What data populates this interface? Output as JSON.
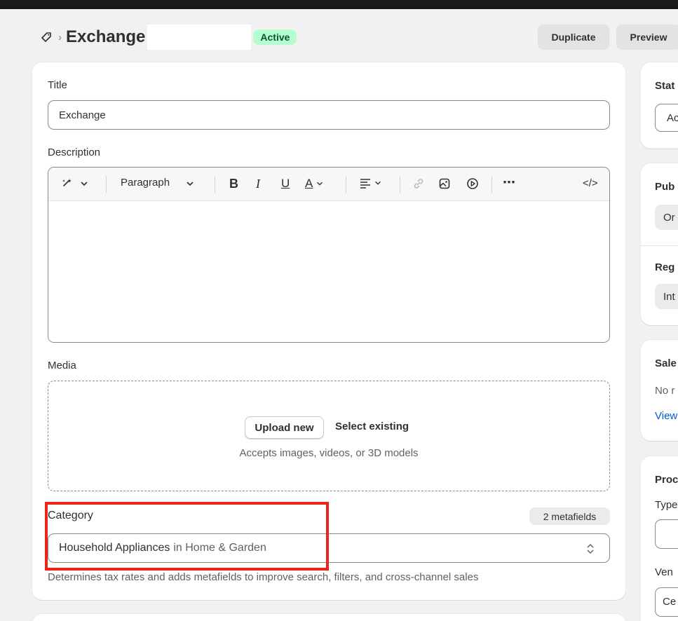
{
  "header": {
    "title": "Exchange",
    "status_badge": "Active",
    "duplicate_label": "Duplicate",
    "preview_label": "Preview"
  },
  "main": {
    "title_label": "Title",
    "title_value": "Exchange",
    "description_label": "Description",
    "toolbar": {
      "paragraph_label": "Paragraph",
      "bold": "B",
      "italic": "I",
      "underline": "U",
      "text_color": "A",
      "more": "⋯",
      "code": "</>"
    },
    "media_label": "Media",
    "upload_new": "Upload new",
    "select_existing": "Select existing",
    "media_hint": "Accepts images, videos, or 3D models",
    "category_label": "Category",
    "metafields_badge": "2 metafields",
    "category_value": "Household Appliances",
    "category_parent": "in Home & Garden",
    "category_help": "Determines tax rates and adds metafields to improve search, filters, and cross-channel sales"
  },
  "sidebar": {
    "status_label": "Stat",
    "status_value": "Ac",
    "publishing_label": "Pub",
    "publishing_value": "Or",
    "regions_label": "Reg",
    "regions_value": "Int",
    "sales_label": "Sale",
    "sales_text": "No r",
    "sales_link": "View",
    "product_org_label": "Proc",
    "type_label": "Type",
    "vendor_label": "Ven",
    "vendor_value": "Ce"
  },
  "colors": {
    "active_badge_bg": "#b4fed2",
    "active_badge_text": "#0c5132",
    "highlight_border": "#e8261c",
    "link": "#005bd3"
  }
}
